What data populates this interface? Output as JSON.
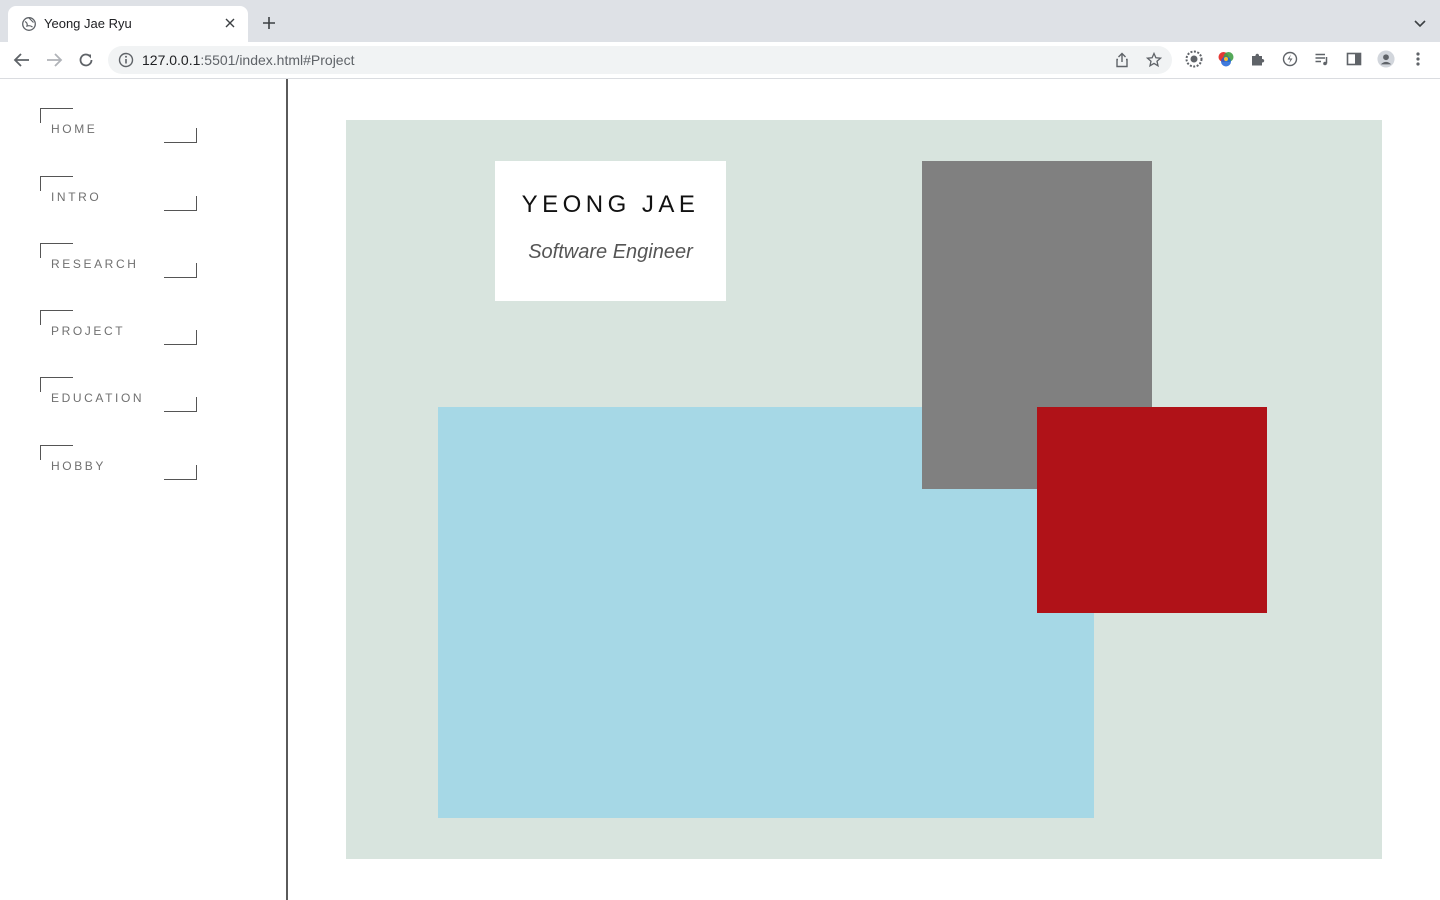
{
  "browser": {
    "tab_title": "Yeong Jae Ryu",
    "url_host": "127.0.0.1",
    "url_rest": ":5501/index.html#Project"
  },
  "sidebar": {
    "items": [
      {
        "label": "HOME"
      },
      {
        "label": "INTRO"
      },
      {
        "label": "RESEARCH"
      },
      {
        "label": "PROJECT"
      },
      {
        "label": "EDUCATION"
      },
      {
        "label": "HOBBY"
      }
    ]
  },
  "hero": {
    "name": "YEONG JAE",
    "role": "Software Engineer"
  },
  "colors": {
    "content_bg": "#d8e4de",
    "blue_block": "#a6d8e6",
    "gray_block": "#808080",
    "red_block": "#b01218"
  }
}
